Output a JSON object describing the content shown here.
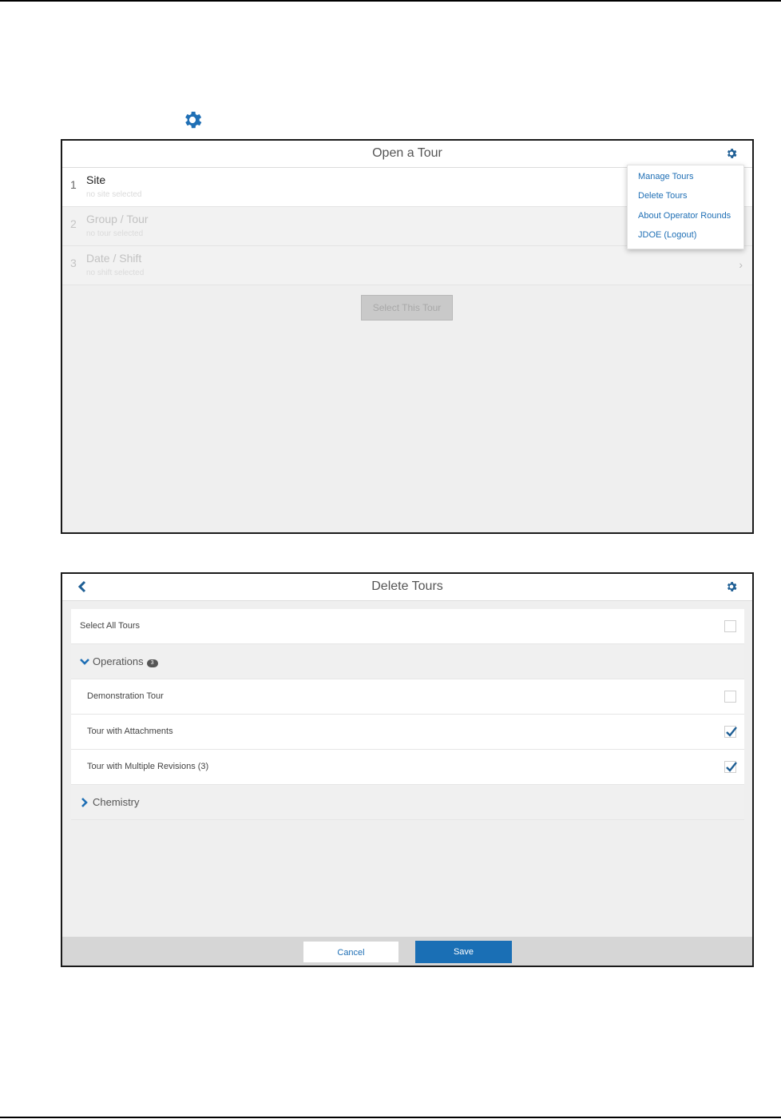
{
  "screen1": {
    "title": "Open a Tour",
    "steps": [
      {
        "num": "1",
        "label": "Site",
        "sub": "no site selected"
      },
      {
        "num": "2",
        "label": "Group / Tour",
        "sub": "no tour selected"
      },
      {
        "num": "3",
        "label": "Date / Shift",
        "sub": "no shift selected"
      }
    ],
    "select_button": "Select This Tour",
    "menu": [
      "Manage Tours",
      "Delete Tours",
      "About Operator Rounds",
      "JDOE (Logout)"
    ],
    "chevron": "›"
  },
  "screen2": {
    "title": "Delete Tours",
    "select_all": "Select All Tours",
    "groups": [
      {
        "label": "Operations",
        "count": "3",
        "expanded": true
      },
      {
        "label": "Chemistry",
        "expanded": false
      }
    ],
    "tours": [
      {
        "label": "Demonstration Tour",
        "checked": false
      },
      {
        "label": "Tour with Attachments",
        "checked": true
      },
      {
        "label": "Tour with Multiple Revisions (3)",
        "checked": true
      }
    ],
    "cancel": "Cancel",
    "save": "Save"
  },
  "icons": {
    "settings": "gear-icon",
    "back": "chevron-left-icon",
    "expand": "chevron-down-icon",
    "collapse": "chevron-right-icon",
    "check": "checkmark-icon"
  },
  "colors": {
    "accent": "#1a6fb5",
    "link": "#1f6fb5",
    "background": "#efefef"
  }
}
